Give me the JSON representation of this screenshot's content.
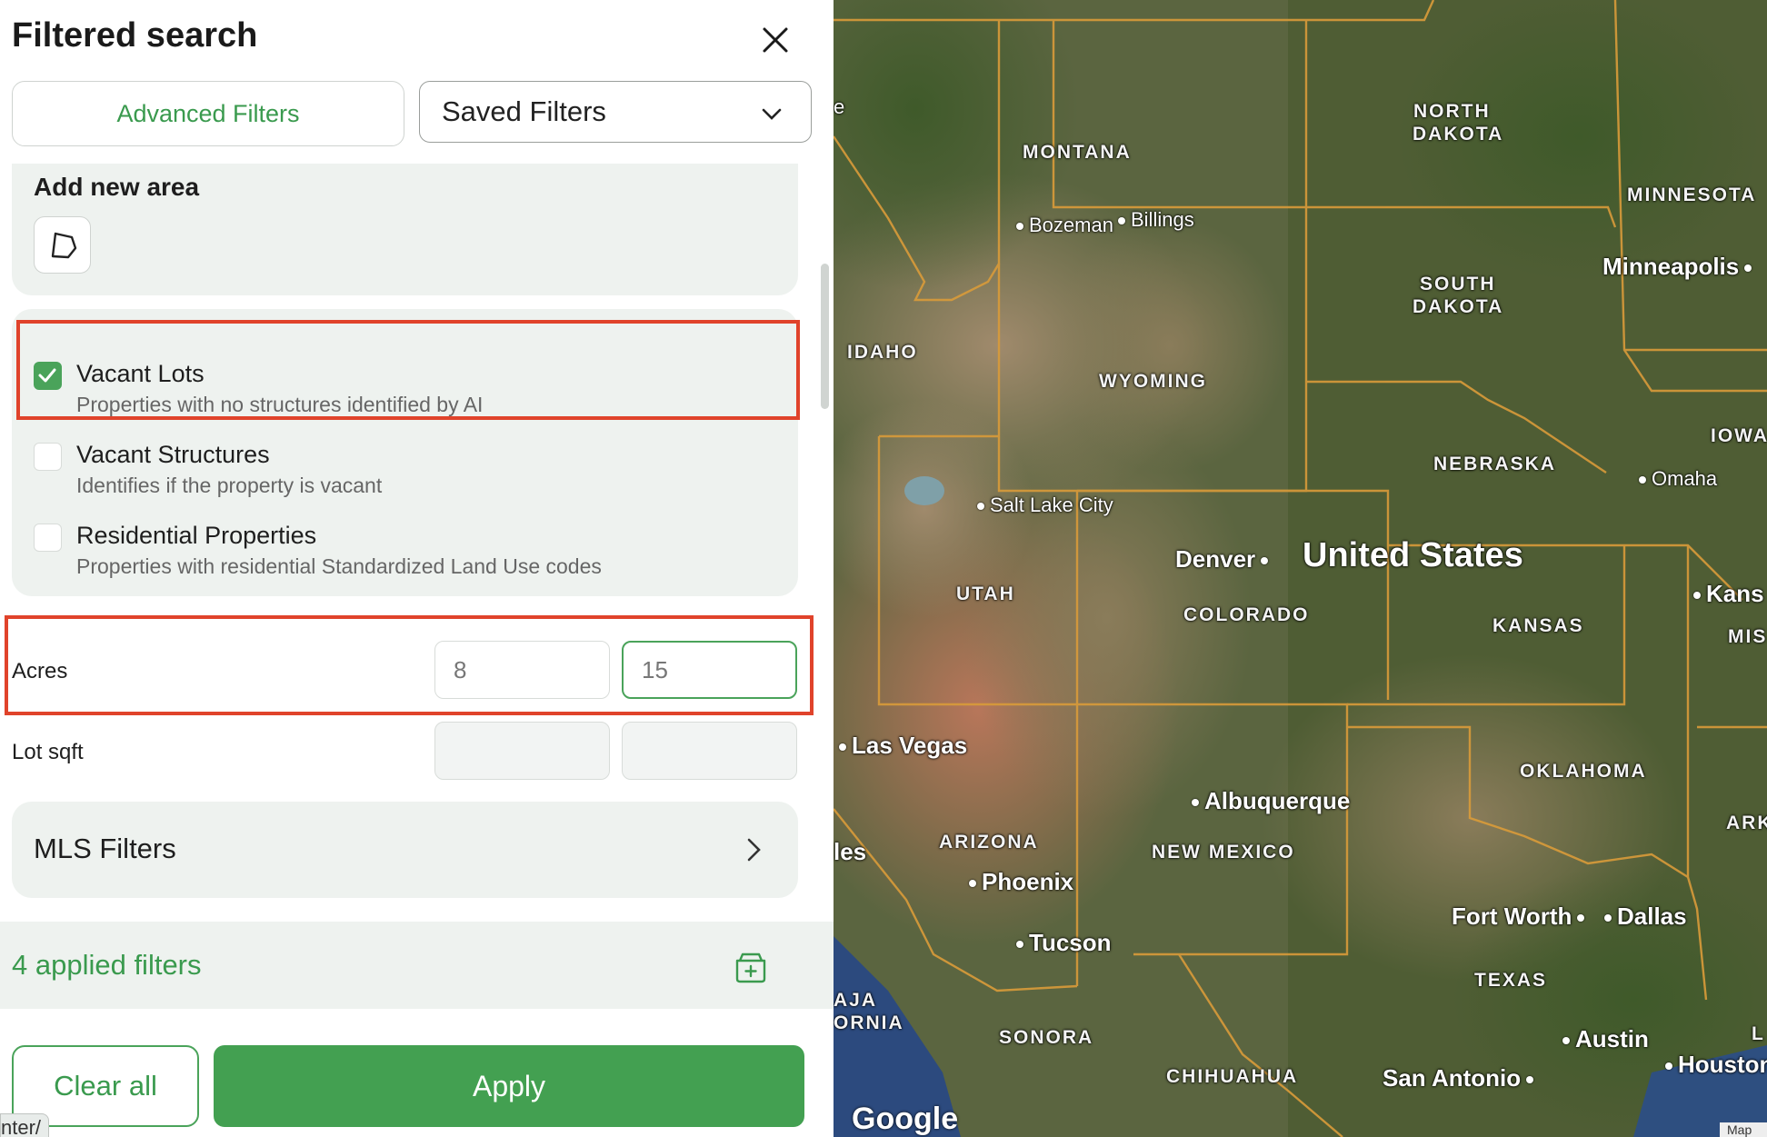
{
  "panel": {
    "title": "Filtered search",
    "tabs": {
      "advanced": "Advanced Filters",
      "saved": "Saved Filters"
    },
    "area": {
      "title": "Add new area"
    },
    "property_types": [
      {
        "label": "Vacant Lots",
        "desc": "Properties with no structures identified by AI",
        "checked": true
      },
      {
        "label": "Vacant Structures",
        "desc": "Identifies if the property is vacant",
        "checked": false
      },
      {
        "label": "Residential Properties",
        "desc": "Properties with residential Standardized Land Use codes",
        "checked": false
      }
    ],
    "fields": {
      "acres": {
        "label": "Acres",
        "min": "8",
        "max": "15"
      },
      "lot_sqft": {
        "label": "Lot sqft",
        "min": "",
        "max": ""
      }
    },
    "mls": {
      "label": "MLS Filters"
    },
    "applied": "4 applied filters",
    "buttons": {
      "clear": "Clear all",
      "apply": "Apply"
    },
    "status_tip": "nter/"
  },
  "colors": {
    "accent": "#43a051",
    "highlight": "#e0432b"
  },
  "map": {
    "states": {
      "montana": "MONTANA",
      "north_dakota_1": "NORTH",
      "north_dakota_2": "DAKOTA",
      "south_dakota_1": "SOUTH",
      "south_dakota_2": "DAKOTA",
      "minnesota": "MINNESOTA",
      "idaho": "IDAHO",
      "wyoming": "WYOMING",
      "nebraska": "NEBRASKA",
      "iowa": "IOWA",
      "utah": "UTAH",
      "colorado": "COLORADO",
      "kansas": "KANSAS",
      "missouri_partial": "MIS",
      "oklahoma": "OKLAHOMA",
      "arkansas_partial": "ARK",
      "arizona": "ARIZONA",
      "new_mexico": "NEW MEXICO",
      "texas": "TEXAS",
      "sonora": "SONORA",
      "chihuahua": "CHIHUAHUA",
      "baja_1": "AJA",
      "baja_2": "ORNIA",
      "louisiana_partial": "L"
    },
    "cities": {
      "bozeman": "Bozeman",
      "billings": "Billings",
      "minneapolis": "Minneapolis",
      "omaha": "Omaha",
      "salt_lake": "Salt Lake City",
      "denver": "Denver",
      "kansas_city": "Kans",
      "las_vegas": "Las Vegas",
      "albuquerque": "Albuquerque",
      "los_angeles_partial": "les",
      "phoenix": "Phoenix",
      "tucson": "Tucson",
      "fort_worth": "Fort Worth",
      "dallas": "Dallas",
      "austin": "Austin",
      "houston": "Houston",
      "san_antonio": "San Antonio",
      "edge_letter": "e"
    },
    "country": "United States",
    "attribution": "Google",
    "corner": "Map"
  }
}
